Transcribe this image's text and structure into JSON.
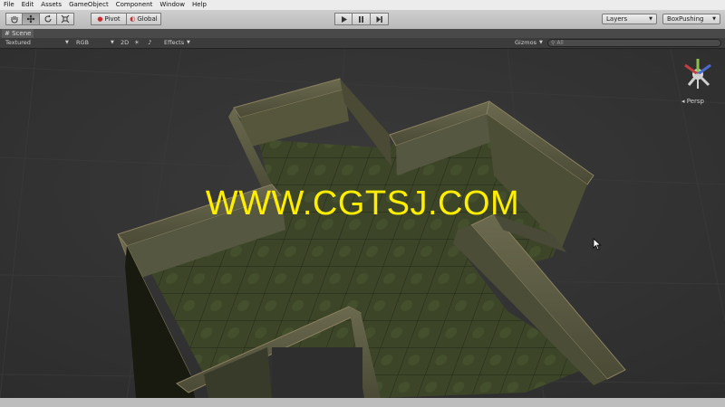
{
  "menu": {
    "items": [
      "File",
      "Edit",
      "Assets",
      "GameObject",
      "Component",
      "Window",
      "Help"
    ]
  },
  "toolbar": {
    "pivot_label": "Pivot",
    "global_label": "Global",
    "layers_label": "Layers",
    "layout_label": "BoxPushing"
  },
  "scene_tab": {
    "label": "Scene"
  },
  "scene_toolbar": {
    "shading_mode": "Textured",
    "render_mode": "RGB",
    "mode_2d": "2D",
    "effects_label": "Effects",
    "gizmos_label": "Gizmos",
    "search_placeholder": "All"
  },
  "viewport": {
    "projection_label": "Persp",
    "watermark": "WWW.CGTSJ.COM",
    "watermark_color": "#ffee00"
  },
  "icons": [
    "hand-tool-icon",
    "move-tool-icon",
    "rotate-tool-icon",
    "scale-tool-icon",
    "play-icon",
    "pause-icon",
    "step-icon",
    "sun-icon",
    "audio-icon",
    "scene-gizmo-icon",
    "mouse-cursor-icon"
  ]
}
